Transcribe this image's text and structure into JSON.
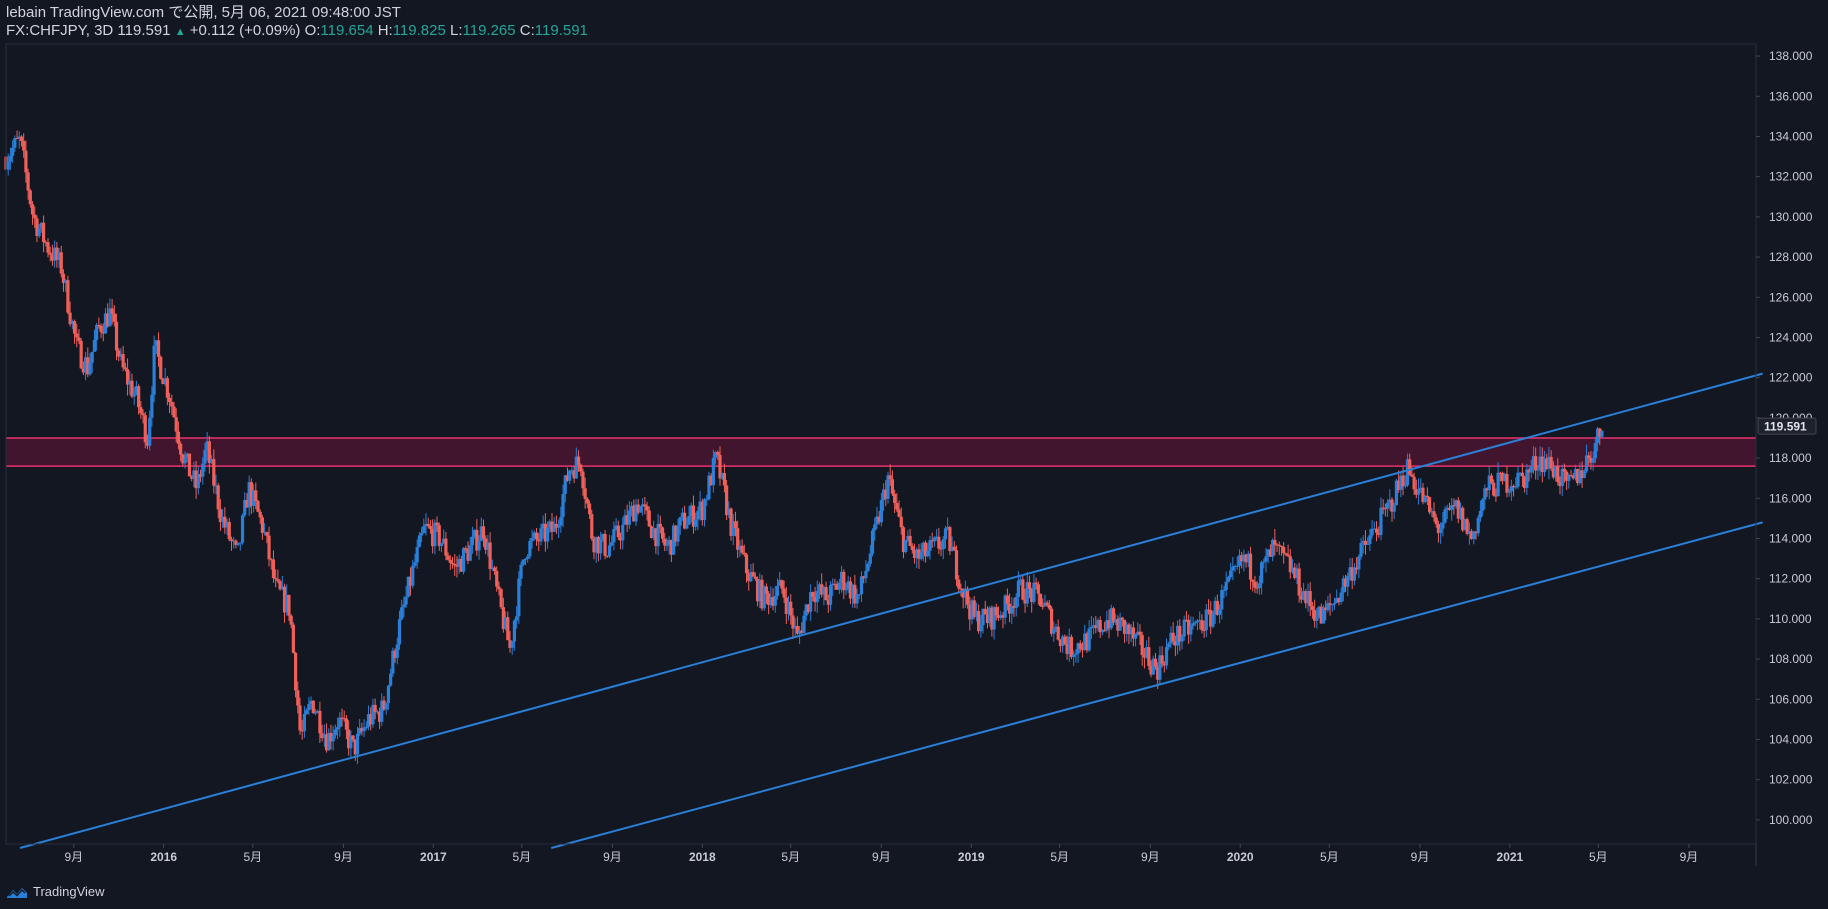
{
  "header": {
    "published": "lebain TradingView.com で公開, 5月 06, 2021 09:48:00 JST",
    "symbol_line": "FX:CHFJPY, 3D 119.591",
    "change": "+0.112 (+0.09%)",
    "o_label": "O:",
    "o_value": "119.654",
    "h_label": "H:",
    "h_value": "119.825",
    "l_label": "L:",
    "l_value": "119.265",
    "c_label": "C:",
    "c_value": "119.591"
  },
  "footer": {
    "brand": "TradingView"
  },
  "colors": {
    "background": "#131722",
    "up": "#2a7fd8",
    "down": "#f0605a",
    "zone_fill": "#4a1530",
    "zone_border": "#e8336b",
    "channel": "#2a7fd8",
    "axis_text": "#c8cbd3"
  },
  "chart_data": {
    "type": "candlestick",
    "symbol": "FX:CHFJPY",
    "timeframe": "3D",
    "last_price": 119.591,
    "last_price_label": "119.591",
    "ylim": [
      98.8,
      138.6
    ],
    "x_range": [
      "2015-06-01",
      "2021-12-01"
    ],
    "y_ticks": [
      100,
      102,
      104,
      106,
      108,
      110,
      112,
      114,
      116,
      118,
      120,
      122,
      124,
      126,
      128,
      130,
      132,
      134,
      136,
      138
    ],
    "y_tick_labels": [
      "100.000",
      "102.000",
      "104.000",
      "106.000",
      "108.000",
      "110.000",
      "112.000",
      "114.000",
      "116.000",
      "118.000",
      "120.000",
      "122.000",
      "124.000",
      "126.000",
      "128.000",
      "130.000",
      "132.000",
      "134.000",
      "136.000",
      "138.000"
    ],
    "x_ticks": [
      {
        "date": "2015-09-01",
        "label": "9月",
        "bold": false
      },
      {
        "date": "2016-01-01",
        "label": "2016",
        "bold": true
      },
      {
        "date": "2016-05-01",
        "label": "5月",
        "bold": false
      },
      {
        "date": "2016-09-01",
        "label": "9月",
        "bold": false
      },
      {
        "date": "2017-01-01",
        "label": "2017",
        "bold": true
      },
      {
        "date": "2017-05-01",
        "label": "5月",
        "bold": false
      },
      {
        "date": "2017-09-01",
        "label": "9月",
        "bold": false
      },
      {
        "date": "2018-01-01",
        "label": "2018",
        "bold": true
      },
      {
        "date": "2018-05-01",
        "label": "5月",
        "bold": false
      },
      {
        "date": "2018-09-01",
        "label": "9月",
        "bold": false
      },
      {
        "date": "2019-01-01",
        "label": "2019",
        "bold": true
      },
      {
        "date": "2019-05-01",
        "label": "5月",
        "bold": false
      },
      {
        "date": "2019-09-01",
        "label": "9月",
        "bold": false
      },
      {
        "date": "2020-01-01",
        "label": "2020",
        "bold": true
      },
      {
        "date": "2020-05-01",
        "label": "5月",
        "bold": false
      },
      {
        "date": "2020-09-01",
        "label": "9月",
        "bold": false
      },
      {
        "date": "2021-01-01",
        "label": "2021",
        "bold": true
      },
      {
        "date": "2021-05-01",
        "label": "5月",
        "bold": false
      },
      {
        "date": "2021-09-01",
        "label": "9月",
        "bold": false
      }
    ],
    "resistance_zone": {
      "low": 117.6,
      "high": 119.0
    },
    "channel_lines": [
      {
        "name": "upper",
        "p1": {
          "date": "2015-06-20",
          "price": 98.6
        },
        "p2": {
          "date": "2021-12-10",
          "price": 122.2
        }
      },
      {
        "name": "lower",
        "p1": {
          "date": "2017-06-10",
          "price": 98.6
        },
        "p2": {
          "date": "2021-12-10",
          "price": 114.8
        }
      }
    ],
    "price_path": [
      {
        "date": "2015-06-01",
        "price": 133.0
      },
      {
        "date": "2015-06-20",
        "price": 133.8
      },
      {
        "date": "2015-07-08",
        "price": 130.0
      },
      {
        "date": "2015-07-28",
        "price": 128.5
      },
      {
        "date": "2015-08-15",
        "price": 127.5
      },
      {
        "date": "2015-09-05",
        "price": 123.5
      },
      {
        "date": "2015-09-20",
        "price": 122.5
      },
      {
        "date": "2015-10-05",
        "price": 124.5
      },
      {
        "date": "2015-10-20",
        "price": 125.2
      },
      {
        "date": "2015-11-05",
        "price": 122.5
      },
      {
        "date": "2015-11-25",
        "price": 121.0
      },
      {
        "date": "2015-12-10",
        "price": 119.0
      },
      {
        "date": "2015-12-20",
        "price": 123.5
      },
      {
        "date": "2016-01-10",
        "price": 121.0
      },
      {
        "date": "2016-01-28",
        "price": 118.0
      },
      {
        "date": "2016-02-15",
        "price": 116.5
      },
      {
        "date": "2016-02-28",
        "price": 118.5
      },
      {
        "date": "2016-03-20",
        "price": 115.0
      },
      {
        "date": "2016-04-10",
        "price": 113.0
      },
      {
        "date": "2016-04-25",
        "price": 116.5
      },
      {
        "date": "2016-05-15",
        "price": 114.5
      },
      {
        "date": "2016-06-01",
        "price": 111.5
      },
      {
        "date": "2016-06-20",
        "price": 110.5
      },
      {
        "date": "2016-07-05",
        "price": 104.0
      },
      {
        "date": "2016-07-20",
        "price": 106.0
      },
      {
        "date": "2016-08-10",
        "price": 104.0
      },
      {
        "date": "2016-08-25",
        "price": 105.0
      },
      {
        "date": "2016-09-15",
        "price": 103.5
      },
      {
        "date": "2016-10-05",
        "price": 105.0
      },
      {
        "date": "2016-10-25",
        "price": 105.5
      },
      {
        "date": "2016-11-15",
        "price": 109.5
      },
      {
        "date": "2016-12-05",
        "price": 112.5
      },
      {
        "date": "2016-12-20",
        "price": 114.5
      },
      {
        "date": "2017-01-10",
        "price": 114.0
      },
      {
        "date": "2017-01-30",
        "price": 112.5
      },
      {
        "date": "2017-02-20",
        "price": 113.5
      },
      {
        "date": "2017-03-10",
        "price": 114.5
      },
      {
        "date": "2017-03-30",
        "price": 111.0
      },
      {
        "date": "2017-04-15",
        "price": 108.5
      },
      {
        "date": "2017-05-05",
        "price": 113.5
      },
      {
        "date": "2017-05-25",
        "price": 114.0
      },
      {
        "date": "2017-06-15",
        "price": 114.5
      },
      {
        "date": "2017-07-05",
        "price": 117.5
      },
      {
        "date": "2017-07-20",
        "price": 117.8
      },
      {
        "date": "2017-08-05",
        "price": 114.0
      },
      {
        "date": "2017-08-25",
        "price": 113.5
      },
      {
        "date": "2017-09-15",
        "price": 114.5
      },
      {
        "date": "2017-10-05",
        "price": 115.8
      },
      {
        "date": "2017-10-25",
        "price": 114.5
      },
      {
        "date": "2017-11-15",
        "price": 113.5
      },
      {
        "date": "2017-12-05",
        "price": 114.8
      },
      {
        "date": "2018-01-01",
        "price": 115.5
      },
      {
        "date": "2018-01-20",
        "price": 118.0
      },
      {
        "date": "2018-02-10",
        "price": 114.5
      },
      {
        "date": "2018-03-01",
        "price": 112.5
      },
      {
        "date": "2018-03-25",
        "price": 111.0
      },
      {
        "date": "2018-04-20",
        "price": 111.5
      },
      {
        "date": "2018-05-10",
        "price": 109.0
      },
      {
        "date": "2018-05-30",
        "price": 111.5
      },
      {
        "date": "2018-06-20",
        "price": 111.0
      },
      {
        "date": "2018-07-10",
        "price": 112.0
      },
      {
        "date": "2018-08-01",
        "price": 111.0
      },
      {
        "date": "2018-08-25",
        "price": 114.5
      },
      {
        "date": "2018-09-10",
        "price": 117.0
      },
      {
        "date": "2018-09-30",
        "price": 114.0
      },
      {
        "date": "2018-10-20",
        "price": 113.0
      },
      {
        "date": "2018-11-10",
        "price": 113.5
      },
      {
        "date": "2018-12-01",
        "price": 114.0
      },
      {
        "date": "2018-12-20",
        "price": 111.5
      },
      {
        "date": "2019-01-05",
        "price": 110.0
      },
      {
        "date": "2019-01-25",
        "price": 110.0
      },
      {
        "date": "2019-02-15",
        "price": 110.5
      },
      {
        "date": "2019-03-10",
        "price": 111.5
      },
      {
        "date": "2019-04-05",
        "price": 111.0
      },
      {
        "date": "2019-04-25",
        "price": 109.5
      },
      {
        "date": "2019-05-15",
        "price": 108.5
      },
      {
        "date": "2019-06-10",
        "price": 109.0
      },
      {
        "date": "2019-07-05",
        "price": 110.0
      },
      {
        "date": "2019-07-30",
        "price": 109.5
      },
      {
        "date": "2019-08-20",
        "price": 108.5
      },
      {
        "date": "2019-09-10",
        "price": 107.5
      },
      {
        "date": "2019-10-01",
        "price": 109.0
      },
      {
        "date": "2019-10-25",
        "price": 109.5
      },
      {
        "date": "2019-11-20",
        "price": 110.0
      },
      {
        "date": "2019-12-15",
        "price": 111.5
      },
      {
        "date": "2020-01-05",
        "price": 113.0
      },
      {
        "date": "2020-01-25",
        "price": 112.0
      },
      {
        "date": "2020-02-15",
        "price": 113.5
      },
      {
        "date": "2020-03-10",
        "price": 112.5
      },
      {
        "date": "2020-03-30",
        "price": 111.0
      },
      {
        "date": "2020-04-20",
        "price": 110.0
      },
      {
        "date": "2020-05-10",
        "price": 111.0
      },
      {
        "date": "2020-06-01",
        "price": 112.5
      },
      {
        "date": "2020-06-25",
        "price": 114.0
      },
      {
        "date": "2020-07-20",
        "price": 115.5
      },
      {
        "date": "2020-08-15",
        "price": 117.5
      },
      {
        "date": "2020-09-05",
        "price": 116.0
      },
      {
        "date": "2020-09-25",
        "price": 114.5
      },
      {
        "date": "2020-10-20",
        "price": 115.5
      },
      {
        "date": "2020-11-10",
        "price": 114.0
      },
      {
        "date": "2020-12-01",
        "price": 116.5
      },
      {
        "date": "2020-12-25",
        "price": 116.8
      },
      {
        "date": "2021-01-20",
        "price": 117.0
      },
      {
        "date": "2021-02-10",
        "price": 118.0
      },
      {
        "date": "2021-03-01",
        "price": 117.5
      },
      {
        "date": "2021-03-20",
        "price": 116.5
      },
      {
        "date": "2021-04-10",
        "price": 117.5
      },
      {
        "date": "2021-04-25",
        "price": 118.5
      },
      {
        "date": "2021-05-06",
        "price": 119.591
      }
    ]
  }
}
